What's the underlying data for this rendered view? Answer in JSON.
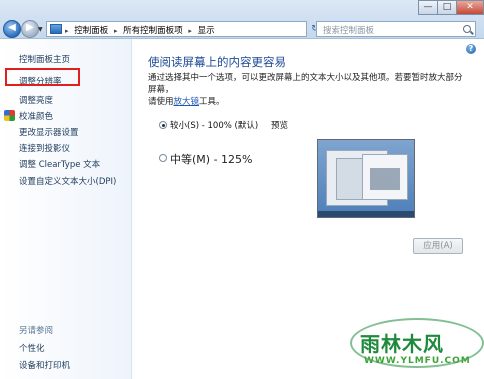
{
  "address_bar": {
    "crumbs": [
      "控制面板",
      "所有控制面板项",
      "显示"
    ],
    "search_placeholder": "搜索控制面板"
  },
  "window_buttons": {
    "minimize": "—",
    "maximize": "□",
    "close": "✕"
  },
  "sidebar": {
    "items": [
      {
        "label": "控制面板主页"
      },
      {
        "label": "调整分辨率"
      },
      {
        "label": "调整亮度"
      },
      {
        "label": "校准颜色"
      },
      {
        "label": "更改显示器设置"
      },
      {
        "label": "连接到投影仪"
      },
      {
        "label": "调整 ClearType 文本"
      },
      {
        "label": "设置自定义文本大小(DPI)"
      }
    ],
    "see_also_title": "另请参阅",
    "see_also": [
      {
        "label": "个性化"
      },
      {
        "label": "设备和打印机"
      }
    ]
  },
  "main": {
    "title": "使阅读屏幕上的内容更容易",
    "desc_line1": "通过选择其中一个选项，可以更改屏幕上的文本大小以及其他项。若要暂时放大部分屏幕，",
    "desc_line2_pre": "请使用",
    "desc_link": "放大镜",
    "desc_line2_post": "工具。",
    "options": [
      {
        "label": "较小(S) - 100% (默认)",
        "selected": true
      },
      {
        "label": "中等(M) - 125%",
        "selected": false
      }
    ],
    "preview_label": "预览",
    "apply_label": "应用(A)",
    "help_glyph": "?"
  },
  "watermark": {
    "text": "雨林木风",
    "url": "WWW.YLMFU.COM"
  },
  "colors": {
    "title_blue": "#1d4a96",
    "link_blue": "#1f57b7",
    "highlight_red": "#e21f1f"
  }
}
